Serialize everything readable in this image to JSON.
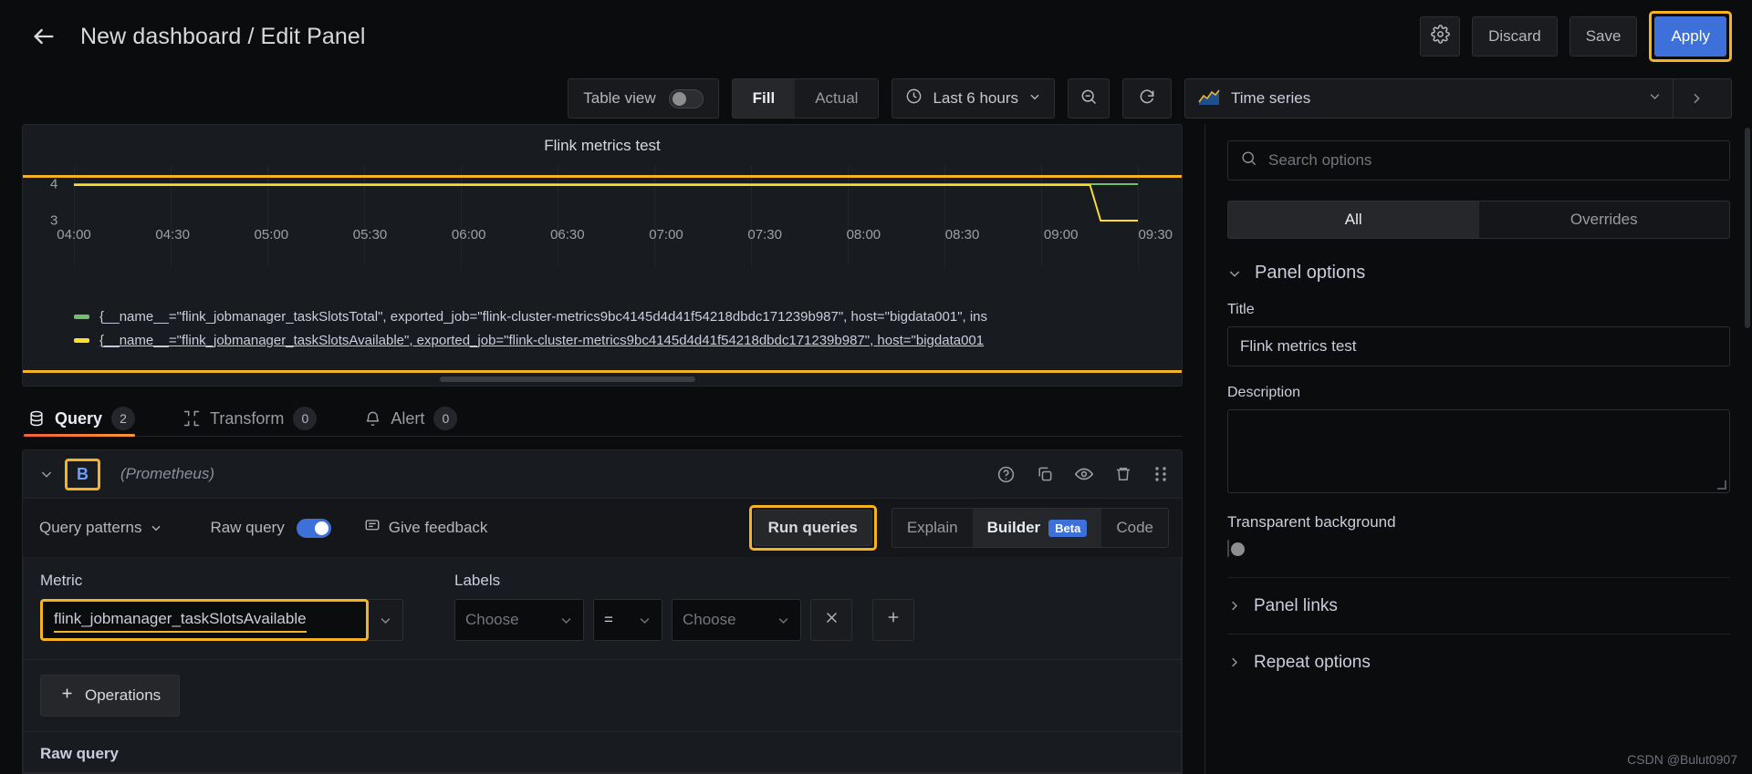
{
  "topbar": {
    "back_icon": "arrow-left-icon",
    "title": "New dashboard / Edit Panel",
    "settings_icon": "gear-icon",
    "discard_label": "Discard",
    "save_label": "Save",
    "apply_label": "Apply",
    "apply_color": "#3d71d9",
    "highlight_color": "#f5b324"
  },
  "subbar": {
    "table_view_label": "Table view",
    "table_view_on": false,
    "fill_label": "Fill",
    "actual_label": "Actual",
    "fill_active": true,
    "time_range_label": "Last 6 hours",
    "clock_icon": "clock-icon",
    "zoom_out_icon": "zoom-out-icon",
    "refresh_icon": "refresh-icon",
    "viz_name": "Time series",
    "viz_icon": "timeseries-icon",
    "chevron_icon": "chevron-down-icon",
    "expand_icon": "chevron-right-icon"
  },
  "panel": {
    "title": "Flink metrics test",
    "scroll_thumb": "horizontal-scrollbar"
  },
  "chart_data": {
    "type": "line",
    "title": "Flink metrics test",
    "xlabel": "",
    "ylabel": "",
    "ylim": [
      3,
      4
    ],
    "yticks": [
      "3",
      "4"
    ],
    "xticks": [
      "04:00",
      "04:30",
      "05:00",
      "05:30",
      "06:00",
      "06:30",
      "07:00",
      "07:30",
      "08:00",
      "08:30",
      "09:00",
      "09:30"
    ],
    "grid": true,
    "legend_position": "bottom",
    "series": [
      {
        "name": "{__name__=\"flink_jobmanager_taskSlotsTotal\", exported_job=\"flink-cluster-metrics9bc4145d4d41f54218dbdc171239b987\", host=\"bigdata001\", ins",
        "color": "#73bf69",
        "x": [
          "04:00",
          "09:30"
        ],
        "values": [
          4,
          4
        ]
      },
      {
        "name": "{__name__=\"flink_jobmanager_taskSlotsAvailable\", exported_job=\"flink-cluster-metrics9bc4145d4d41f54218dbdc171239b987\", host=\"bigdata001",
        "color": "#fade2a",
        "x": [
          "04:00",
          "09:20",
          "09:22",
          "09:30"
        ],
        "values": [
          4,
          4,
          3,
          3
        ],
        "selected": true
      }
    ]
  },
  "query_tabs": [
    {
      "label": "Query",
      "count": "2",
      "icon": "database-icon",
      "active": true
    },
    {
      "label": "Transform",
      "count": "0",
      "icon": "transform-icon",
      "active": false
    },
    {
      "label": "Alert",
      "count": "0",
      "icon": "bell-icon",
      "active": false
    }
  ],
  "query_row": {
    "collapse_icon": "chevron-down-icon",
    "ref_id": "B",
    "datasource": "(Prometheus)",
    "actions": [
      {
        "name": "help-icon"
      },
      {
        "name": "duplicate-icon"
      },
      {
        "name": "eye-icon"
      },
      {
        "name": "trash-icon"
      },
      {
        "name": "drag-handle-icon"
      }
    ]
  },
  "query_toolbar": {
    "query_patterns_label": "Query patterns",
    "raw_query_label": "Raw query",
    "raw_query_on": true,
    "give_feedback_label": "Give feedback",
    "feedback_icon": "comment-icon",
    "run_queries_label": "Run queries",
    "explain_label": "Explain",
    "builder_label": "Builder",
    "beta_label": "Beta",
    "code_label": "Code",
    "builder_active": true
  },
  "metric_section": {
    "metric_label": "Metric",
    "metric_value": "flink_jobmanager_taskSlotsAvailable",
    "labels_label": "Labels",
    "label_choose_placeholder": "Choose",
    "operator_value": "=",
    "value_choose_placeholder": "Choose",
    "remove_icon": "close-icon",
    "add_icon": "plus-icon"
  },
  "operations": {
    "label": "Operations",
    "plus_icon": "plus-icon"
  },
  "raw_query_section": {
    "label": "Raw query"
  },
  "options_pane": {
    "search_placeholder": "Search options",
    "search_icon": "search-icon",
    "tab_all": "All",
    "tab_overrides": "Overrides",
    "active_tab": "All",
    "panel_options_title": "Panel options",
    "title_label": "Title",
    "title_value": "Flink metrics test",
    "description_label": "Description",
    "description_value": "",
    "transparent_bg_label": "Transparent background",
    "transparent_bg_on": false,
    "panel_links_label": "Panel links",
    "repeat_options_label": "Repeat options"
  },
  "watermark": "CSDN @Bulut0907"
}
